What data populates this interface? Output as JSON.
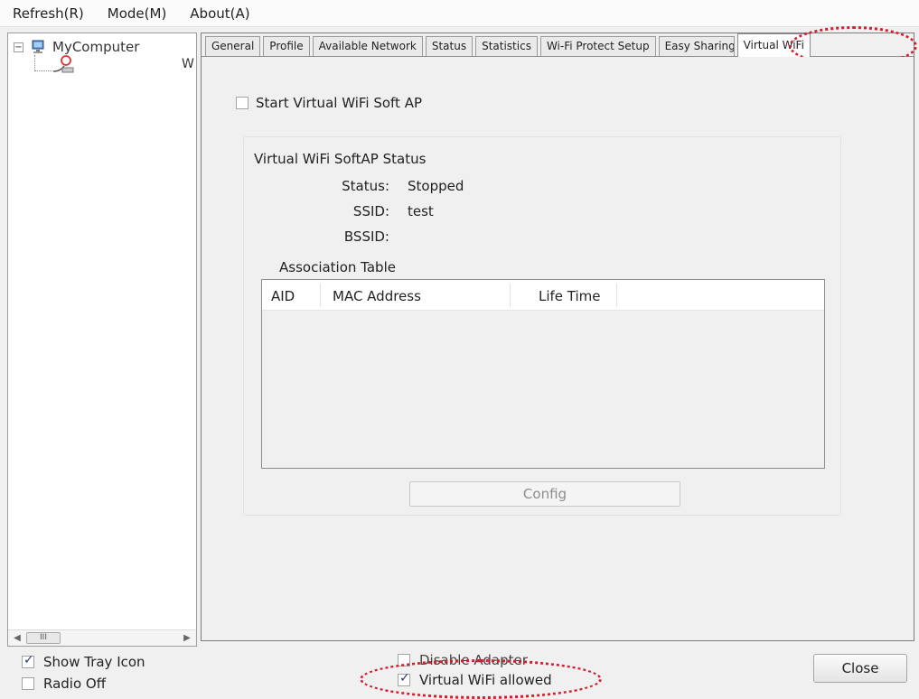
{
  "menu": {
    "items": [
      "Refresh(R)",
      "Mode(M)",
      "About(A)"
    ]
  },
  "tree": {
    "root_label": "MyComputer",
    "expander": "−",
    "child_label": "W"
  },
  "scroll": {
    "left_arrow": "◀",
    "right_arrow": "▶",
    "thumb_label": "III"
  },
  "tabs": {
    "items": [
      "General",
      "Profile",
      "Available Network",
      "Status",
      "Statistics",
      "Wi-Fi Protect Setup",
      "Easy Sharing",
      "Virtual WiFi"
    ],
    "active": "Virtual WiFi"
  },
  "virtual_wifi": {
    "start_ap_label": "Start Virtual WiFi Soft AP",
    "start_ap_checked": false,
    "group_title": "Virtual WiFi SoftAP Status",
    "status_label": "Status:",
    "status_value": "Stopped",
    "ssid_label": "SSID:",
    "ssid_value": "test",
    "bssid_label": "BSSID:",
    "bssid_value": "",
    "association_title": "Association Table",
    "columns": [
      "AID",
      "MAC Address",
      "Life Time"
    ],
    "rows": [],
    "config_label": "Config"
  },
  "footer": {
    "show_tray_label": "Show Tray Icon",
    "show_tray_checked": true,
    "radio_off_label": "Radio Off",
    "radio_off_checked": false,
    "disable_adapter_label": "Disable Adapter",
    "disable_adapter_checked": false,
    "virtual_wifi_allowed_label": "Virtual WiFi allowed",
    "virtual_wifi_allowed_checked": true,
    "close_label": "Close"
  },
  "colors": {
    "highlight": "#d21f2f",
    "disabled_text": "#8d8d8d"
  }
}
